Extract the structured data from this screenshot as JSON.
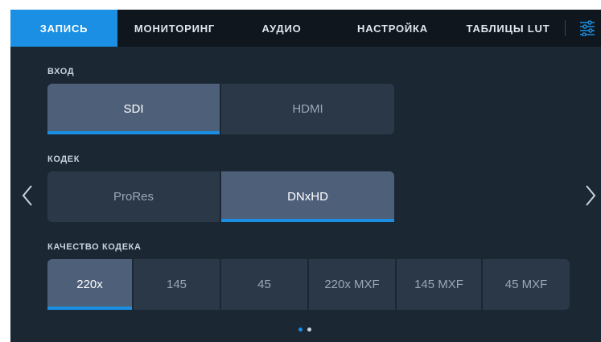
{
  "tabs": [
    {
      "label": "ЗАПИСЬ",
      "active": true
    },
    {
      "label": "МОНИТОРИНГ",
      "active": false
    },
    {
      "label": "АУДИО",
      "active": false
    },
    {
      "label": "НАСТРОЙКА",
      "active": false
    },
    {
      "label": "ТАБЛИЦЫ LUT",
      "active": false
    }
  ],
  "menu_icon": "sliders-icon",
  "sections": {
    "input": {
      "label": "ВХОД",
      "options": [
        "SDI",
        "HDMI"
      ],
      "selected": "SDI"
    },
    "codec": {
      "label": "КОДЕК",
      "options": [
        "ProRes",
        "DNxHD"
      ],
      "selected": "DNxHD"
    },
    "quality": {
      "label": "КАЧЕСТВО КОДЕКА",
      "options": [
        "220x",
        "145",
        "45",
        "220x MXF",
        "145 MXF",
        "45 MXF"
      ],
      "selected": "220x"
    }
  },
  "pagination": {
    "current_page": 1,
    "total_pages": 2
  },
  "colors": {
    "accent": "#1a8fe3",
    "panel_bg": "#1b2733",
    "topbar_bg": "#0f161d",
    "button_bg": "#2a3848",
    "button_selected_bg": "#4e6079"
  }
}
